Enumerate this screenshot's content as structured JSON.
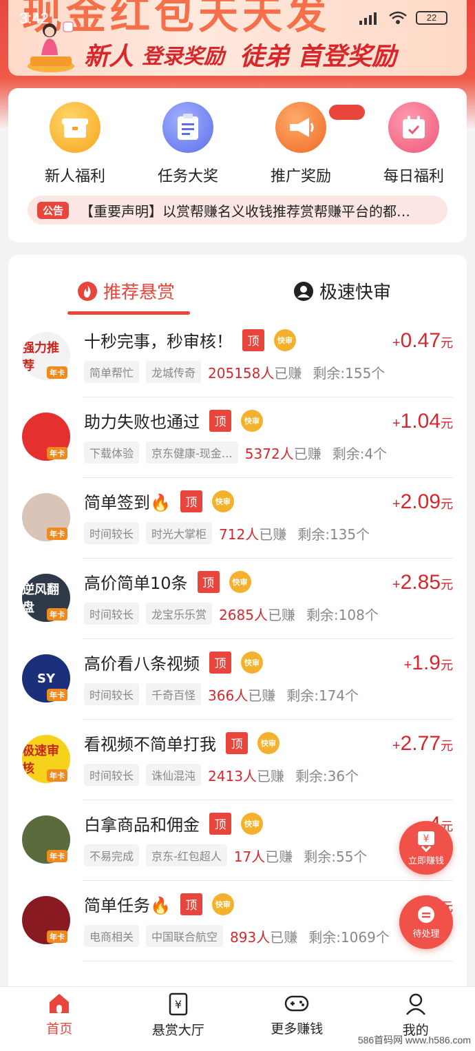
{
  "status_bar": {
    "time": "3:42",
    "battery": "22"
  },
  "banner": {
    "big_text": "现金红包天天发",
    "slogan_part1": "新人",
    "slogan_part2": "登录奖励",
    "slogan_part3": "徒弟",
    "slogan_part4": "首登奖励"
  },
  "quick_actions": [
    {
      "label": "新人福利",
      "icon": "gift-box-icon",
      "color": "#f9b42a"
    },
    {
      "label": "任务大奖",
      "icon": "clipboard-icon",
      "color": "#6e7ff0"
    },
    {
      "label": "推广奖励",
      "icon": "megaphone-icon",
      "color": "#f2762e"
    },
    {
      "label": "每日福利",
      "icon": "calendar-check-icon",
      "color": "#f0677c"
    }
  ],
  "notice": {
    "tag": "公告",
    "text": "【重要声明】以赏帮赚名义收钱推荐赏帮赚平台的都…"
  },
  "tabs": [
    {
      "label": "推荐悬赏",
      "active": true
    },
    {
      "label": "极速快审",
      "active": false
    }
  ],
  "badges": {
    "top": "顶",
    "fast": "快审",
    "year": "年卡"
  },
  "tasks": [
    {
      "title": "十秒完事，秒审核！",
      "tag1": "简单帮忙",
      "tag2": "龙城传奇",
      "earned_count": "205158人",
      "earned_suffix": "已赚",
      "remaining": "剩余:155个",
      "price_plus": "+",
      "price": "0.47",
      "unit": "元",
      "avatar_text": "强力推荐",
      "avatar_color": "#f2f2f2"
    },
    {
      "title": "助力失败也通过",
      "tag1": "下载体验",
      "tag2": "京东健康-现金…",
      "earned_count": "5372人",
      "earned_suffix": "已赚",
      "remaining": "剩余:4个",
      "price_plus": "+",
      "price": "1.04",
      "unit": "元",
      "avatar_text": "",
      "avatar_color": "#e53030"
    },
    {
      "title": "简单签到🔥",
      "tag1": "时间较长",
      "tag2": "时光大掌柜",
      "earned_count": "712人",
      "earned_suffix": "已赚",
      "remaining": "剩余:135个",
      "price_plus": "+",
      "price": "2.09",
      "unit": "元",
      "avatar_text": "",
      "avatar_color": "#d9c4b8"
    },
    {
      "title": "高价简单10条",
      "tag1": "时间较长",
      "tag2": "龙宝乐乐赏",
      "earned_count": "2685人",
      "earned_suffix": "已赚",
      "remaining": "剩余:108个",
      "price_plus": "+",
      "price": "2.85",
      "unit": "元",
      "avatar_text": "逆风翻盘",
      "avatar_color": "#2e3a4a"
    },
    {
      "title": "高价看八条视频",
      "tag1": "时间较长",
      "tag2": "千奇百怪",
      "earned_count": "366人",
      "earned_suffix": "已赚",
      "remaining": "剩余:174个",
      "price_plus": "+",
      "price": "1.9",
      "unit": "元",
      "avatar_text": "SY",
      "avatar_color": "#1c2f7a"
    },
    {
      "title": "看视频不简单打我",
      "tag1": "时间较长",
      "tag2": "诛仙混沌",
      "earned_count": "2413人",
      "earned_suffix": "已赚",
      "remaining": "剩余:36个",
      "price_plus": "+",
      "price": "2.77",
      "unit": "元",
      "avatar_text": "极速审核",
      "avatar_color": "#f7d21c"
    },
    {
      "title": "白拿商品和佣金",
      "tag1": "不易完成",
      "tag2": "京东-红包超人",
      "earned_count": "17人",
      "earned_suffix": "已赚",
      "remaining": "剩余:55个",
      "price_plus": "+",
      "price": "4",
      "unit": "元",
      "avatar_text": "",
      "avatar_color": "#5a6b3e"
    },
    {
      "title": "简单任务🔥",
      "tag1": "电商相关",
      "tag2": "中国联合航空",
      "earned_count": "893人",
      "earned_suffix": "已赚",
      "remaining": "剩余:1069个",
      "price_plus": "+",
      "price": "0",
      "unit": "元",
      "avatar_text": "",
      "avatar_color": "#8a1a22"
    }
  ],
  "floating": {
    "earn_label": "立即赚钱",
    "pending_label": "待处理"
  },
  "bottom_nav": [
    {
      "label": "首页",
      "active": true
    },
    {
      "label": "悬赏大厅",
      "active": false
    },
    {
      "label": "更多赚钱",
      "active": false
    },
    {
      "label": "我的",
      "active": false
    }
  ],
  "watermark": "586首码网 www.h586.com"
}
